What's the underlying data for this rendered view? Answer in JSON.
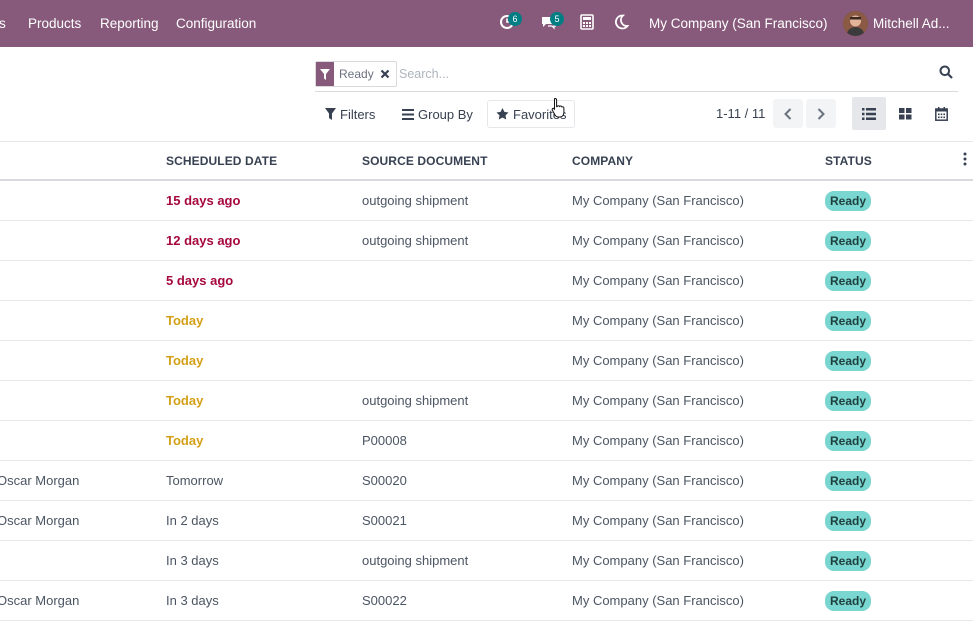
{
  "navbar": {
    "menus": [
      "s",
      "Products",
      "Reporting",
      "Configuration"
    ],
    "activity_count": "6",
    "messages_count": "5",
    "company": "My Company (San Francisco)",
    "user": "Mitchell Ad..."
  },
  "search": {
    "facet_label": "Ready",
    "placeholder": "Search...",
    "filters_label": "Filters",
    "groupby_label": "Group By",
    "favorites_label": "Favorites"
  },
  "pager": {
    "value": "1-11 / 11"
  },
  "table": {
    "headers": [
      "Scheduled Date",
      "Source Document",
      "Company",
      "Status"
    ],
    "rows": [
      {
        "contact": "",
        "date": "15 days ago",
        "date_state": "late",
        "source": "outgoing shipment",
        "company": "My Company (San Francisco)",
        "status": "Ready"
      },
      {
        "contact": "",
        "date": "12 days ago",
        "date_state": "late",
        "source": "outgoing shipment",
        "company": "My Company (San Francisco)",
        "status": "Ready"
      },
      {
        "contact": "",
        "date": "5 days ago",
        "date_state": "late",
        "source": "",
        "company": "My Company (San Francisco)",
        "status": "Ready"
      },
      {
        "contact": "",
        "date": "Today",
        "date_state": "today",
        "source": "",
        "company": "My Company (San Francisco)",
        "status": "Ready"
      },
      {
        "contact": "",
        "date": "Today",
        "date_state": "today",
        "source": "",
        "company": "My Company (San Francisco)",
        "status": "Ready"
      },
      {
        "contact": "",
        "date": "Today",
        "date_state": "today",
        "source": "outgoing shipment",
        "company": "My Company (San Francisco)",
        "status": "Ready"
      },
      {
        "contact": "",
        "date": "Today",
        "date_state": "today",
        "source": "P00008",
        "company": "My Company (San Francisco)",
        "status": "Ready"
      },
      {
        "contact": "Oscar Morgan",
        "date": "Tomorrow",
        "date_state": "future",
        "source": "S00020",
        "company": "My Company (San Francisco)",
        "status": "Ready"
      },
      {
        "contact": "Oscar Morgan",
        "date": "In 2 days",
        "date_state": "future",
        "source": "S00021",
        "company": "My Company (San Francisco)",
        "status": "Ready"
      },
      {
        "contact": "",
        "date": "In 3 days",
        "date_state": "future",
        "source": "outgoing shipment",
        "company": "My Company (San Francisco)",
        "status": "Ready"
      },
      {
        "contact": "Oscar Morgan",
        "date": "In 3 days",
        "date_state": "future",
        "source": "S00022",
        "company": "My Company (San Francisco)",
        "status": "Ready"
      }
    ]
  },
  "colors": {
    "navbar": "#875a7b",
    "late": "#a5073e",
    "today": "#d4a017",
    "status_badge": "#79d6d0",
    "counter_badge": "#017e84"
  },
  "icons": {
    "activity": "clock-icon",
    "messages": "chat-icon",
    "calculator": "calculator-icon",
    "theme": "moon-icon",
    "search": "search-icon",
    "filter": "filter-icon",
    "groupby": "bars-icon",
    "favorites": "star-icon",
    "views": [
      "list-view-icon",
      "kanban-view-icon",
      "calendar-view-icon"
    ]
  }
}
